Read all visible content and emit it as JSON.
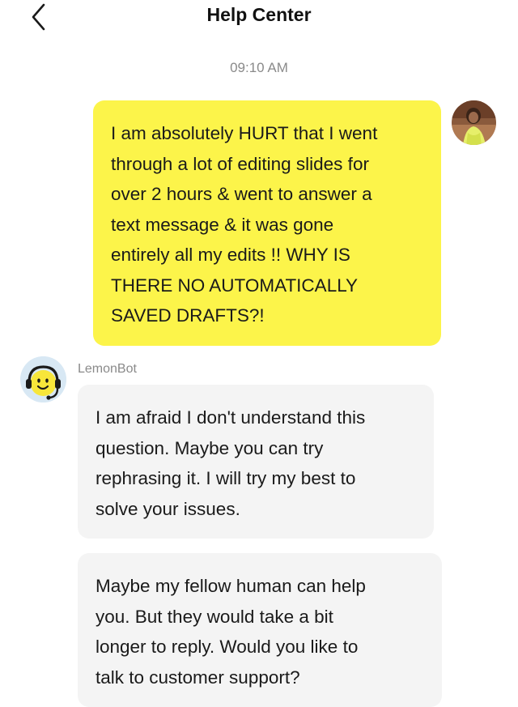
{
  "header": {
    "title": "Help Center",
    "back_icon": "chevron-left-icon"
  },
  "chat": {
    "timestamp": "09:10 AM",
    "user_message": {
      "avatar_icon": "user-avatar-photo",
      "lines": [
        "I am absolutely HURT that I went",
        "through a lot of editing slides for",
        "over 2 hours & went to answer a",
        "text message & it was gone",
        "entirely all my edits !! WHY IS",
        "THERE NO AUTOMATICALLY",
        "SAVED DRAFTS?!"
      ]
    },
    "bot": {
      "name": "LemonBot",
      "avatar_icon": "lemonbot-headset-icon",
      "messages": [
        {
          "lines": [
            "I am afraid I don't understand this",
            "question. Maybe you can try",
            "rephrasing it. I will try my best to",
            "solve your issues."
          ]
        },
        {
          "lines": [
            "Maybe my fellow human can help",
            "you. But they would take a bit",
            "longer to reply. Would you like to",
            "talk to customer support?"
          ]
        }
      ]
    }
  },
  "colors": {
    "user_bubble": "#fcf44a",
    "bot_bubble": "#f4f4f4",
    "timestamp_text": "#8a8a8a",
    "bot_avatar_bg": "#d8e8f4",
    "bot_face": "#f7e63a"
  }
}
